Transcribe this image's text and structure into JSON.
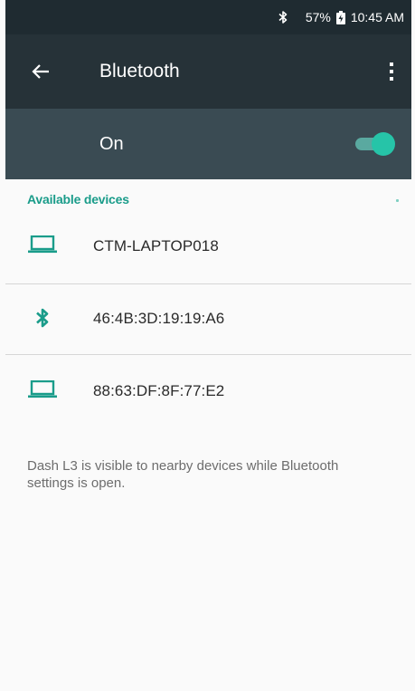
{
  "status_bar": {
    "bluetooth_icon": "bluetooth-icon",
    "battery_percent": "57%",
    "battery_icon": "battery-charging-icon",
    "time": "10:45 AM"
  },
  "app_bar": {
    "back_icon": "arrow-back-icon",
    "title": "Bluetooth",
    "overflow_icon": "more-vert-icon"
  },
  "master_switch": {
    "label": "On",
    "state": "on",
    "accent_color": "#26c4a8"
  },
  "available_section": {
    "title": "Available devices",
    "devices": [
      {
        "name": "CTM-LAPTOP018",
        "icon": "laptop-icon"
      },
      {
        "name": "46:4B:3D:19:19:A6",
        "icon": "bluetooth-icon"
      },
      {
        "name": "88:63:DF:8F:77:E2",
        "icon": "laptop-icon"
      }
    ]
  },
  "visibility_note": "Dash L3 is visible to nearby devices while Bluetooth settings is open.",
  "colors": {
    "status_bar": "#1f2b31",
    "app_bar": "#263238",
    "switch_bar": "#3a4b53",
    "accent": "#1a9c8a"
  }
}
